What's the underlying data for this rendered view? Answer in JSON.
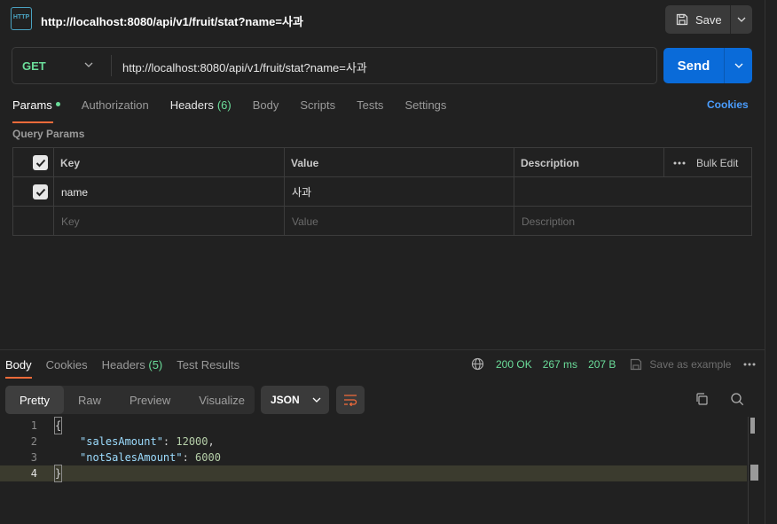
{
  "request": {
    "icon_label": "HTTP",
    "title": "http://localhost:8080/api/v1/fruit/stat?name=사과",
    "save_label": "Save",
    "method": "GET",
    "url": "http://localhost:8080/api/v1/fruit/stat?name=사과",
    "send_label": "Send"
  },
  "request_tabs": [
    {
      "label": "Params",
      "active": true
    },
    {
      "label": "Authorization"
    },
    {
      "label": "Headers",
      "count": "(6)"
    },
    {
      "label": "Body"
    },
    {
      "label": "Scripts"
    },
    {
      "label": "Tests"
    },
    {
      "label": "Settings"
    }
  ],
  "cookies_label": "Cookies",
  "query_params": {
    "section_label": "Query Params",
    "headers": {
      "key": "Key",
      "value": "Value",
      "description": "Description",
      "bulk_edit": "Bulk Edit"
    },
    "rows": [
      {
        "checked": true,
        "key": "name",
        "value": "사과",
        "description": ""
      }
    ],
    "placeholders": {
      "key": "Key",
      "value": "Value",
      "description": "Description"
    }
  },
  "response": {
    "tabs": [
      {
        "label": "Body",
        "active": true
      },
      {
        "label": "Cookies"
      },
      {
        "label": "Headers",
        "count": "(5)"
      },
      {
        "label": "Test Results"
      }
    ],
    "status": "200 OK",
    "time": "267 ms",
    "size": "207 B",
    "save_example": "Save as example",
    "view_tabs": [
      "Pretty",
      "Raw",
      "Preview",
      "Visualize"
    ],
    "format": "JSON",
    "code_lines": [
      {
        "n": "1",
        "text": "{"
      },
      {
        "n": "2",
        "key": "\"salesAmount\"",
        "sep": ": ",
        "val": "12000",
        "end": ","
      },
      {
        "n": "3",
        "key": "\"notSalesAmount\"",
        "sep": ": ",
        "val": "6000",
        "end": ""
      },
      {
        "n": "4",
        "text": "}"
      }
    ]
  },
  "colors": {
    "accent_green": "#6bdd9a",
    "send_blue": "#0a6bd9",
    "active_tab": "#f26b3a",
    "link_blue": "#4a9dff"
  }
}
